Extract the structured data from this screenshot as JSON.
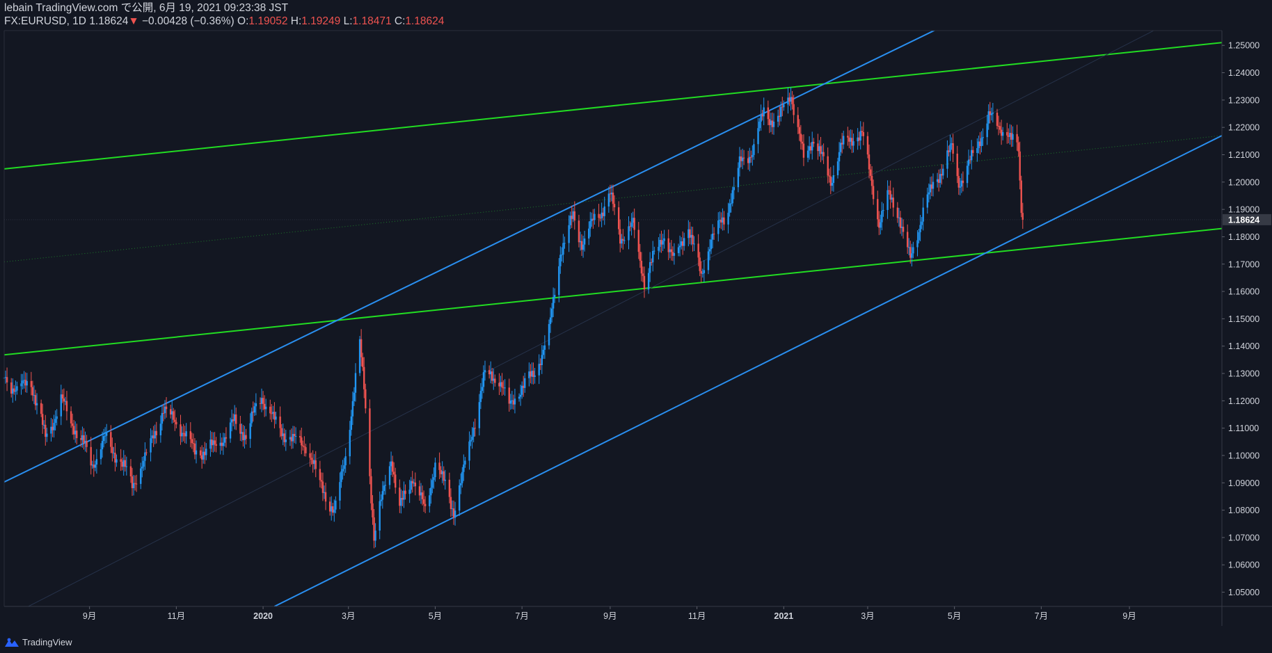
{
  "header": {
    "publish_line": "lebain TradingView.com で公開, 6月 19, 2021 09:23:38 JST",
    "symbol": "FX:EURUSD, 1D",
    "last": "1.18624",
    "change_arrow": "▼",
    "change": "−0.00428 (−0.36%)",
    "o_label": "O:",
    "o_value": "1.19052",
    "h_label": "H:",
    "h_value": "1.19249",
    "l_label": "L:",
    "l_value": "1.18471",
    "c_label": "C:",
    "c_value": "1.18624"
  },
  "footer": {
    "brand": "TradingView",
    "brand_icon": "tradingview-logo-icon"
  },
  "colors": {
    "background": "#131722",
    "up": "#2196f3",
    "down": "#ef5350",
    "trend_green": "#22dd22",
    "trend_blue": "#2a8ff0",
    "grid_text": "#d1d4dc"
  },
  "chart_data": {
    "type": "candlestick",
    "symbol": "FX:EURUSD",
    "interval": "1D",
    "last_price": 1.18624,
    "ylim": [
      1.0448,
      1.2554
    ],
    "y_ticks": [
      "1.05000",
      "1.06000",
      "1.07000",
      "1.08000",
      "1.09000",
      "1.10000",
      "1.11000",
      "1.12000",
      "1.13000",
      "1.14000",
      "1.15000",
      "1.16000",
      "1.17000",
      "1.18000",
      "1.19000",
      "1.20000",
      "1.21000",
      "1.22000",
      "1.23000",
      "1.24000",
      "1.25000"
    ],
    "x_ticks": [
      {
        "label": "9月",
        "date": "2019-09-01"
      },
      {
        "label": "11月",
        "date": "2019-11-01"
      },
      {
        "label": "2020",
        "date": "2020-01-01"
      },
      {
        "label": "3月",
        "date": "2020-03-01"
      },
      {
        "label": "5月",
        "date": "2020-05-01"
      },
      {
        "label": "7月",
        "date": "2020-07-01"
      },
      {
        "label": "9月",
        "date": "2020-09-01"
      },
      {
        "label": "11月",
        "date": "2020-11-01"
      },
      {
        "label": "2021",
        "date": "2021-01-01"
      },
      {
        "label": "3月",
        "date": "2021-03-01"
      },
      {
        "label": "5月",
        "date": "2021-05-01"
      },
      {
        "label": "7月",
        "date": "2021-07-01"
      },
      {
        "label": "9月",
        "date": "2021-09-01"
      }
    ],
    "x_range": [
      "2019-07-03",
      "2021-11-05"
    ],
    "path_points": [
      [
        "2019-07-03",
        1.1285
      ],
      [
        "2019-07-12",
        1.124
      ],
      [
        "2019-07-22",
        1.127
      ],
      [
        "2019-08-01",
        1.106
      ],
      [
        "2019-08-12",
        1.12
      ],
      [
        "2019-08-22",
        1.11
      ],
      [
        "2019-09-03",
        1.097
      ],
      [
        "2019-09-12",
        1.106
      ],
      [
        "2019-09-25",
        1.096
      ],
      [
        "2019-10-01",
        1.089
      ],
      [
        "2019-10-10",
        1.099
      ],
      [
        "2019-10-23",
        1.117
      ],
      [
        "2019-11-06",
        1.109
      ],
      [
        "2019-11-14",
        1.101
      ],
      [
        "2019-11-28",
        1.103
      ],
      [
        "2019-12-12",
        1.112
      ],
      [
        "2019-12-20",
        1.108
      ],
      [
        "2019-12-31",
        1.122
      ],
      [
        "2020-01-10",
        1.111
      ],
      [
        "2020-01-20",
        1.106
      ],
      [
        "2020-01-31",
        1.104
      ],
      [
        "2020-02-10",
        1.09
      ],
      [
        "2020-02-20",
        1.079
      ],
      [
        "2020-02-28",
        1.1
      ],
      [
        "2020-03-09",
        1.14
      ],
      [
        "2020-03-12",
        1.125
      ],
      [
        "2020-03-19",
        1.07
      ],
      [
        "2020-03-25",
        1.085
      ],
      [
        "2020-03-31",
        1.1
      ],
      [
        "2020-04-06",
        1.08
      ],
      [
        "2020-04-15",
        1.093
      ],
      [
        "2020-04-24",
        1.079
      ],
      [
        "2020-05-01",
        1.098
      ],
      [
        "2020-05-14",
        1.08
      ],
      [
        "2020-05-20",
        1.092
      ],
      [
        "2020-06-05",
        1.13
      ],
      [
        "2020-06-15",
        1.128
      ],
      [
        "2020-06-22",
        1.118
      ],
      [
        "2020-07-01",
        1.125
      ],
      [
        "2020-07-10",
        1.13
      ],
      [
        "2020-07-20",
        1.145
      ],
      [
        "2020-07-28",
        1.175
      ],
      [
        "2020-08-06",
        1.187
      ],
      [
        "2020-08-12",
        1.178
      ],
      [
        "2020-08-20",
        1.185
      ],
      [
        "2020-09-01",
        1.195
      ],
      [
        "2020-09-08",
        1.18
      ],
      [
        "2020-09-17",
        1.184
      ],
      [
        "2020-09-25",
        1.164
      ],
      [
        "2020-10-01",
        1.172
      ],
      [
        "2020-10-09",
        1.181
      ],
      [
        "2020-10-16",
        1.171
      ],
      [
        "2020-10-26",
        1.184
      ],
      [
        "2020-11-04",
        1.165
      ],
      [
        "2020-11-11",
        1.18
      ],
      [
        "2020-11-20",
        1.186
      ],
      [
        "2020-12-01",
        1.206
      ],
      [
        "2020-12-10",
        1.212
      ],
      [
        "2020-12-18",
        1.225
      ],
      [
        "2020-12-28",
        1.222
      ],
      [
        "2021-01-06",
        1.233
      ],
      [
        "2021-01-15",
        1.208
      ],
      [
        "2021-01-22",
        1.217
      ],
      [
        "2021-02-03",
        1.2
      ],
      [
        "2021-02-10",
        1.213
      ],
      [
        "2021-02-25",
        1.218
      ],
      [
        "2021-03-09",
        1.185
      ],
      [
        "2021-03-15",
        1.195
      ],
      [
        "2021-03-22",
        1.19
      ],
      [
        "2021-03-31",
        1.171
      ],
      [
        "2021-04-09",
        1.19
      ],
      [
        "2021-04-20",
        1.203
      ],
      [
        "2021-04-29",
        1.212
      ],
      [
        "2021-05-04",
        1.2
      ],
      [
        "2021-05-12",
        1.207
      ],
      [
        "2021-05-25",
        1.224
      ],
      [
        "2021-05-31",
        1.221
      ],
      [
        "2021-06-07",
        1.218
      ],
      [
        "2021-06-10",
        1.215
      ],
      [
        "2021-06-15",
        1.212
      ],
      [
        "2021-06-16",
        1.2
      ],
      [
        "2021-06-17",
        1.191
      ],
      [
        "2021-06-18",
        1.1862
      ]
    ],
    "trendlines": [
      {
        "color": "green",
        "style": "solid",
        "from": [
          "2019-07-03",
          1.2048
        ],
        "to": [
          "2021-11-05",
          1.251
        ]
      },
      {
        "color": "green",
        "style": "solid",
        "from": [
          "2019-07-03",
          1.1368
        ],
        "to": [
          "2021-11-05",
          1.183
        ]
      },
      {
        "color": "green",
        "style": "dotted",
        "from": [
          "2019-07-03",
          1.1708
        ],
        "to": [
          "2021-11-05",
          1.217
        ]
      },
      {
        "color": "blue",
        "style": "solid",
        "from": [
          "2019-07-03",
          1.0903
        ],
        "to": [
          "2021-11-01",
          1.3055
        ]
      },
      {
        "color": "blue",
        "style": "solid",
        "from": [
          "2020-01-09",
          1.0448
        ],
        "to": [
          "2021-11-05",
          1.217
        ]
      },
      {
        "color": "blue",
        "style": "faint",
        "from": [
          "2019-07-20",
          1.0448
        ],
        "to": [
          "2021-09-18",
          1.2554
        ]
      }
    ]
  }
}
